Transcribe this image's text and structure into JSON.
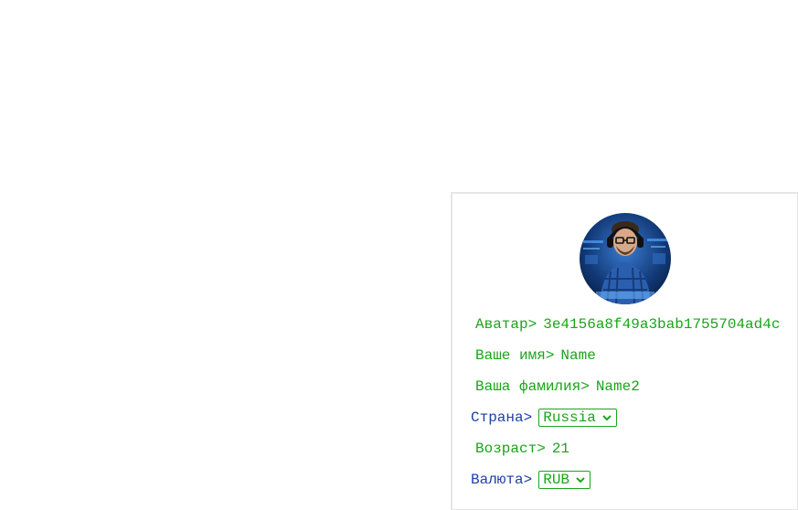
{
  "profile": {
    "avatar_label": "Аватар>",
    "avatar_value": "3e4156a8f49a3bab1755704ad4c",
    "first_name_label": "Ваше имя>",
    "first_name_value": "Name",
    "last_name_label": "Ваша фамилия>",
    "last_name_value": "Name2",
    "country_label": "Страна>",
    "country_selected": "Russia",
    "age_label": "Возраст>",
    "age_value": "21",
    "currency_label": "Валюта>",
    "currency_selected": "RUB"
  },
  "colors": {
    "label_green": "#1aa51a",
    "label_blue": "#1f3fa8",
    "card_border": "#e6e6e6"
  },
  "icons": {
    "avatar": "user-photo",
    "dropdown": "chevron-down-icon"
  }
}
